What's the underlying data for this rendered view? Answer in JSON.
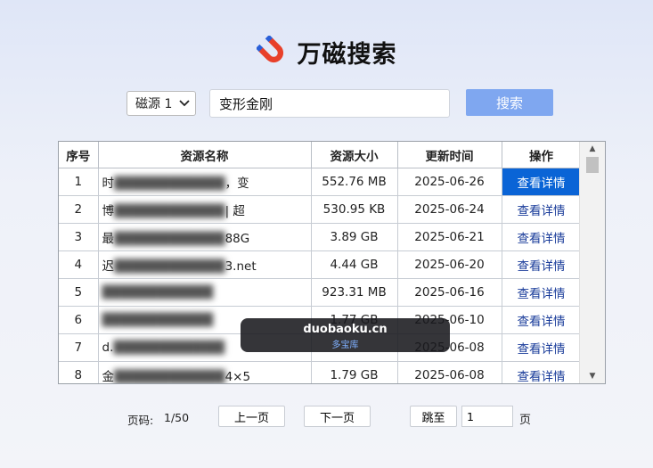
{
  "app": {
    "title": "万磁搜索"
  },
  "search": {
    "source": "磁源 1",
    "query": "变形金刚",
    "button_label": "搜索"
  },
  "table": {
    "headers": [
      "序号",
      "资源名称",
      "资源大小",
      "更新时间",
      "操作"
    ],
    "rows": [
      {
        "idx": "1",
        "name_start": "时",
        "name_end": "，变",
        "size": "552.76 MB",
        "date": "2025-06-26",
        "action": "查看详情",
        "selected": true
      },
      {
        "idx": "2",
        "name_start": "博",
        "name_end": "| 超",
        "size": "530.95 KB",
        "date": "2025-06-24",
        "action": "查看详情",
        "selected": false
      },
      {
        "idx": "3",
        "name_start": "最",
        "name_end": "88G",
        "size": "3.89 GB",
        "date": "2025-06-21",
        "action": "查看详情",
        "selected": false
      },
      {
        "idx": "4",
        "name_start": "迟",
        "name_end": "3.net",
        "size": "4.44 GB",
        "date": "2025-06-20",
        "action": "查看详情",
        "selected": false
      },
      {
        "idx": "5",
        "name_start": "",
        "name_end": "",
        "size": "923.31 MB",
        "date": "2025-06-16",
        "action": "查看详情",
        "selected": false
      },
      {
        "idx": "6",
        "name_start": "",
        "name_end": "",
        "size": "1.77 GB",
        "date": "2025-06-10",
        "action": "查看详情",
        "selected": false
      },
      {
        "idx": "7",
        "name_start": "d.",
        "name_end": "",
        "size": "",
        "date": "2025-06-08",
        "action": "查看详情",
        "selected": false
      },
      {
        "idx": "8",
        "name_start": "金",
        "name_end": "4×5",
        "size": "1.79 GB",
        "date": "2025-06-08",
        "action": "查看详情",
        "selected": false
      }
    ]
  },
  "watermark": {
    "main": "duobaoku.cn",
    "sub": "多宝库"
  },
  "pagination": {
    "page_label": "页码:",
    "page_value": "1/50",
    "prev_label": "上一页",
    "next_label": "下一页",
    "goto_label": "跳至",
    "goto_value": "1",
    "unit_label": "页"
  },
  "colors": {
    "accent": "#7fa7f0",
    "selected": "#0a64d6",
    "link": "#1a3c9a"
  },
  "icons": {
    "logo": "magnet-icon",
    "dropdown": "chevron-down-icon"
  }
}
